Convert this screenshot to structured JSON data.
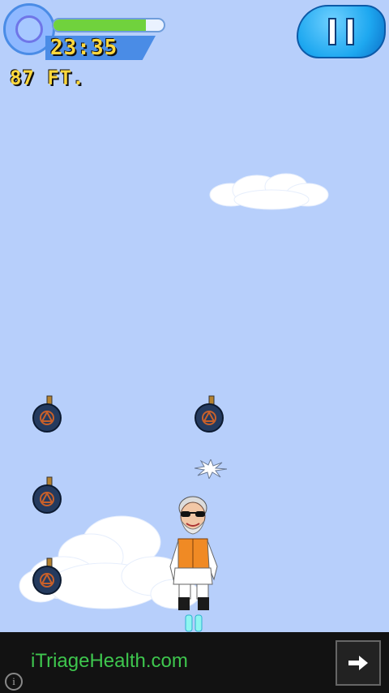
{
  "hud": {
    "timer": "23:35",
    "distance": "87 FT.",
    "health_fraction": 0.84,
    "health_color": "#70d23d"
  },
  "pause": {
    "icon": "pause-icon"
  },
  "ad": {
    "text": "iTriageHealth.com",
    "arrow_icon": "arrow-right-icon",
    "info_icon": "info-icon",
    "info_glyph": "i"
  },
  "colors": {
    "sky": "#b7cffb",
    "ad_text": "#3ec64e"
  }
}
